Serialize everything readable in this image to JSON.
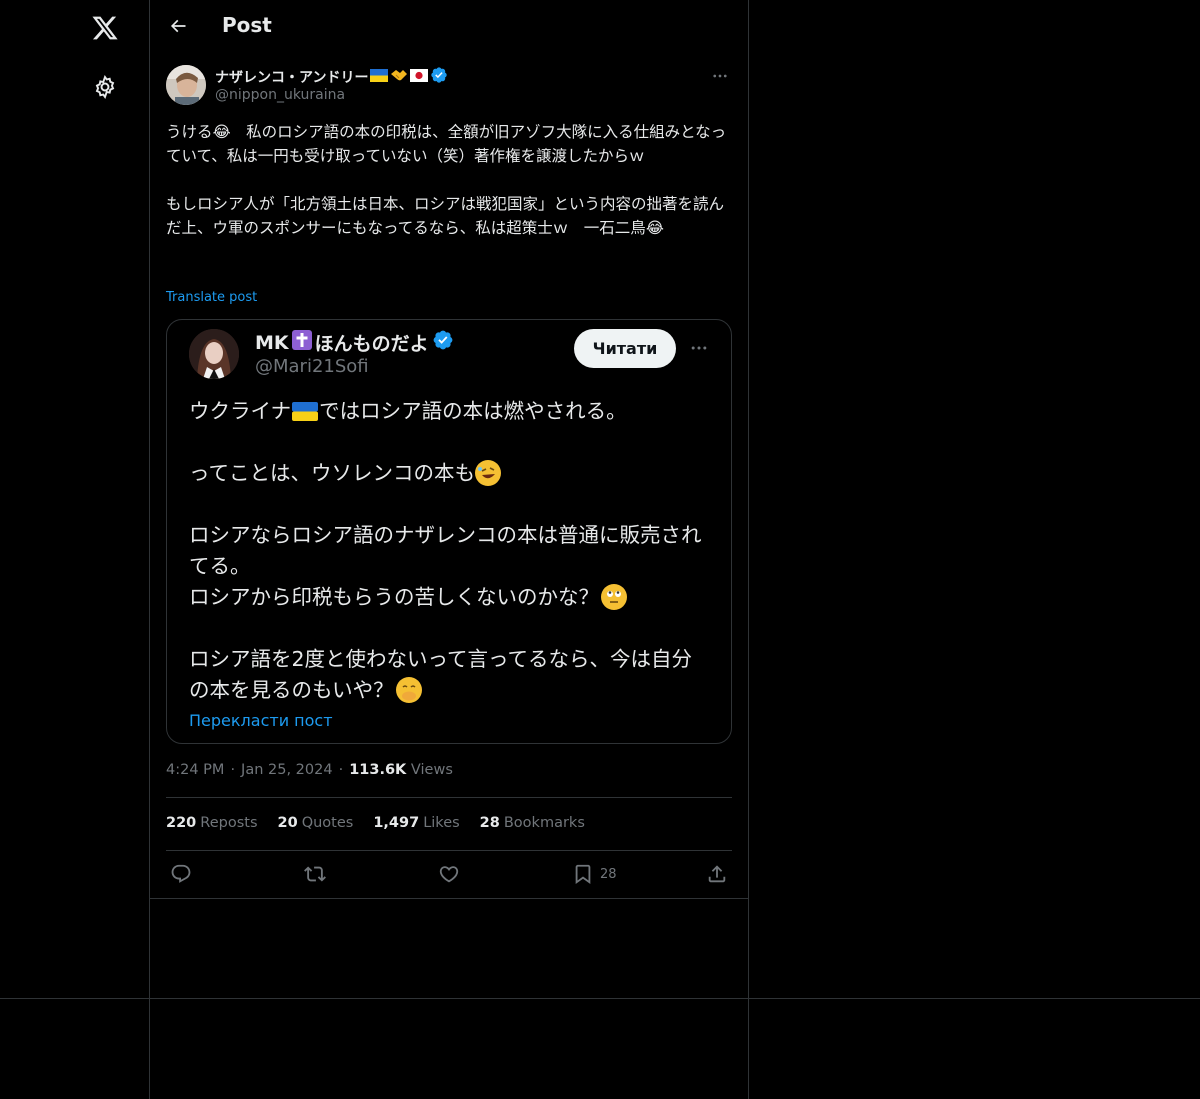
{
  "header": {
    "title": "Post"
  },
  "post": {
    "author_name": "ナザレンコ・アンドリー",
    "author_handle": "@nippon_ukuraina",
    "paragraphs": [
      "うける😂　私のロシア語の本の印税は、全額が旧アゾフ大隊に入る仕組みとなっていて、私は一円も受け取っていない（笑）著作権を譲渡したからｗ",
      "もしロシア人が「北方領土は日本、ロシアは戦犯国家」という内容の拙著を読んだ上、ウ軍のスポンサーにもなってるなら、私は超策士ｗ　一石二鳥😂"
    ],
    "translate_label": "Translate post",
    "time": "4:24 PM",
    "date": "Jan 25, 2024",
    "views_count": "113.6K",
    "views_label": "Views",
    "reposts_count": "220",
    "reposts_label": "Reposts",
    "quotes_count": "20",
    "quotes_label": "Quotes",
    "likes_count": "1,497",
    "likes_label": "Likes",
    "bookmarks_count": "28",
    "bookmarks_label": "Bookmarks",
    "bookmark_action_count": "28"
  },
  "quoted": {
    "name_prefix": "MK",
    "name_suffix": "ほんものだよ",
    "handle": "@Mari21Sofi",
    "follow_label": "Читати",
    "lines": [
      [
        "ウクライナ",
        "ではロシア語の本は燃やされる。"
      ],
      [
        "ってことは、ウソレンコの本も"
      ],
      [
        "ロシアならロシア語のナザレンコの本は普通に販売されてる。",
        "ロシアから印税もらうの苦しくないのかな？"
      ],
      [
        "ロシア語を2度と使わないって言ってるなら、今は自分の本を見るのもいや？"
      ]
    ],
    "translate_label": "Перекласти пост"
  },
  "icons": {
    "logo": "x-logo-icon",
    "settings": "gear-icon",
    "back": "back-arrow-icon",
    "more": "more-dots-icon",
    "verified": "verified-badge-icon",
    "reply": "reply-icon",
    "repost": "repost-icon",
    "like": "heart-icon",
    "bookmark": "bookmark-icon",
    "share": "share-icon"
  },
  "colors": {
    "background": "#000000",
    "text": "#e7e9ea",
    "muted": "#71767b",
    "accent": "#1d9bf0",
    "border": "#2f3336"
  }
}
